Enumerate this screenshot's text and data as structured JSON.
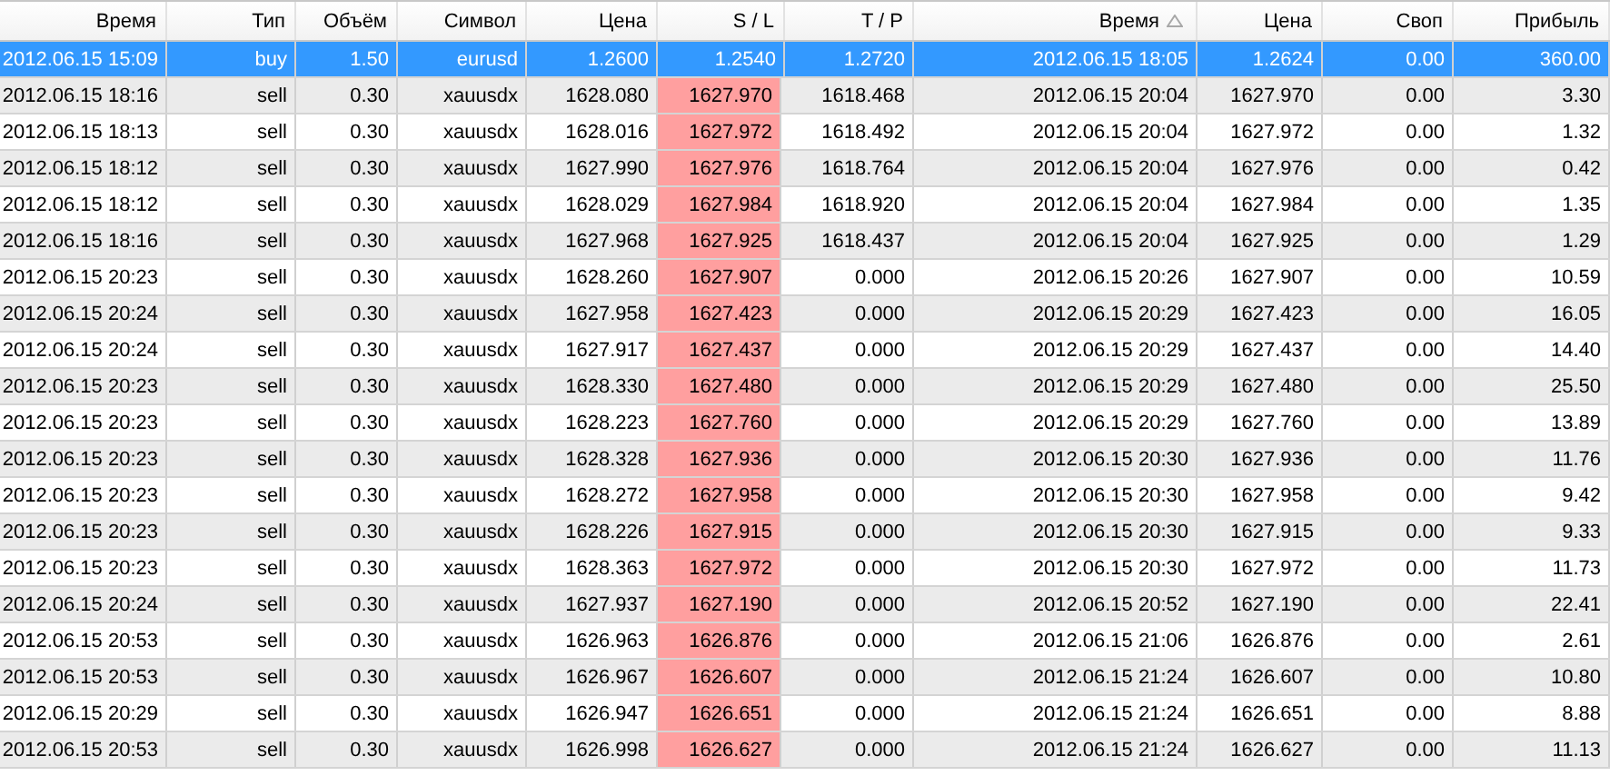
{
  "table": {
    "columns": [
      {
        "label": "Время"
      },
      {
        "label": "Тип"
      },
      {
        "label": "Объём"
      },
      {
        "label": "Символ"
      },
      {
        "label": "Цена"
      },
      {
        "label": "S / L"
      },
      {
        "label": "T / P"
      },
      {
        "label": "Время",
        "sorted": true
      },
      {
        "label": "Цена"
      },
      {
        "label": "Своп"
      },
      {
        "label": "Прибыль"
      }
    ],
    "rows": [
      {
        "selected": true,
        "sl_hit": false,
        "cells": [
          "2012.06.15 15:09",
          "buy",
          "1.50",
          "eurusd",
          "1.2600",
          "1.2540",
          "1.2720",
          "2012.06.15 18:05",
          "1.2624",
          "0.00",
          "360.00"
        ]
      },
      {
        "selected": false,
        "sl_hit": true,
        "cells": [
          "2012.06.15 18:16",
          "sell",
          "0.30",
          "xauusdx",
          "1628.080",
          "1627.970",
          "1618.468",
          "2012.06.15 20:04",
          "1627.970",
          "0.00",
          "3.30"
        ]
      },
      {
        "selected": false,
        "sl_hit": true,
        "cells": [
          "2012.06.15 18:13",
          "sell",
          "0.30",
          "xauusdx",
          "1628.016",
          "1627.972",
          "1618.492",
          "2012.06.15 20:04",
          "1627.972",
          "0.00",
          "1.32"
        ]
      },
      {
        "selected": false,
        "sl_hit": true,
        "cells": [
          "2012.06.15 18:12",
          "sell",
          "0.30",
          "xauusdx",
          "1627.990",
          "1627.976",
          "1618.764",
          "2012.06.15 20:04",
          "1627.976",
          "0.00",
          "0.42"
        ]
      },
      {
        "selected": false,
        "sl_hit": true,
        "cells": [
          "2012.06.15 18:12",
          "sell",
          "0.30",
          "xauusdx",
          "1628.029",
          "1627.984",
          "1618.920",
          "2012.06.15 20:04",
          "1627.984",
          "0.00",
          "1.35"
        ]
      },
      {
        "selected": false,
        "sl_hit": true,
        "cells": [
          "2012.06.15 18:16",
          "sell",
          "0.30",
          "xauusdx",
          "1627.968",
          "1627.925",
          "1618.437",
          "2012.06.15 20:04",
          "1627.925",
          "0.00",
          "1.29"
        ]
      },
      {
        "selected": false,
        "sl_hit": true,
        "cells": [
          "2012.06.15 20:23",
          "sell",
          "0.30",
          "xauusdx",
          "1628.260",
          "1627.907",
          "0.000",
          "2012.06.15 20:26",
          "1627.907",
          "0.00",
          "10.59"
        ]
      },
      {
        "selected": false,
        "sl_hit": true,
        "cells": [
          "2012.06.15 20:24",
          "sell",
          "0.30",
          "xauusdx",
          "1627.958",
          "1627.423",
          "0.000",
          "2012.06.15 20:29",
          "1627.423",
          "0.00",
          "16.05"
        ]
      },
      {
        "selected": false,
        "sl_hit": true,
        "cells": [
          "2012.06.15 20:24",
          "sell",
          "0.30",
          "xauusdx",
          "1627.917",
          "1627.437",
          "0.000",
          "2012.06.15 20:29",
          "1627.437",
          "0.00",
          "14.40"
        ]
      },
      {
        "selected": false,
        "sl_hit": true,
        "cells": [
          "2012.06.15 20:23",
          "sell",
          "0.30",
          "xauusdx",
          "1628.330",
          "1627.480",
          "0.000",
          "2012.06.15 20:29",
          "1627.480",
          "0.00",
          "25.50"
        ]
      },
      {
        "selected": false,
        "sl_hit": true,
        "cells": [
          "2012.06.15 20:23",
          "sell",
          "0.30",
          "xauusdx",
          "1628.223",
          "1627.760",
          "0.000",
          "2012.06.15 20:29",
          "1627.760",
          "0.00",
          "13.89"
        ]
      },
      {
        "selected": false,
        "sl_hit": true,
        "cells": [
          "2012.06.15 20:23",
          "sell",
          "0.30",
          "xauusdx",
          "1628.328",
          "1627.936",
          "0.000",
          "2012.06.15 20:30",
          "1627.936",
          "0.00",
          "11.76"
        ]
      },
      {
        "selected": false,
        "sl_hit": true,
        "cells": [
          "2012.06.15 20:23",
          "sell",
          "0.30",
          "xauusdx",
          "1628.272",
          "1627.958",
          "0.000",
          "2012.06.15 20:30",
          "1627.958",
          "0.00",
          "9.42"
        ]
      },
      {
        "selected": false,
        "sl_hit": true,
        "cells": [
          "2012.06.15 20:23",
          "sell",
          "0.30",
          "xauusdx",
          "1628.226",
          "1627.915",
          "0.000",
          "2012.06.15 20:30",
          "1627.915",
          "0.00",
          "9.33"
        ]
      },
      {
        "selected": false,
        "sl_hit": true,
        "cells": [
          "2012.06.15 20:23",
          "sell",
          "0.30",
          "xauusdx",
          "1628.363",
          "1627.972",
          "0.000",
          "2012.06.15 20:30",
          "1627.972",
          "0.00",
          "11.73"
        ]
      },
      {
        "selected": false,
        "sl_hit": true,
        "cells": [
          "2012.06.15 20:24",
          "sell",
          "0.30",
          "xauusdx",
          "1627.937",
          "1627.190",
          "0.000",
          "2012.06.15 20:52",
          "1627.190",
          "0.00",
          "22.41"
        ]
      },
      {
        "selected": false,
        "sl_hit": true,
        "cells": [
          "2012.06.15 20:53",
          "sell",
          "0.30",
          "xauusdx",
          "1626.963",
          "1626.876",
          "0.000",
          "2012.06.15 21:06",
          "1626.876",
          "0.00",
          "2.61"
        ]
      },
      {
        "selected": false,
        "sl_hit": true,
        "cells": [
          "2012.06.15 20:53",
          "sell",
          "0.30",
          "xauusdx",
          "1626.967",
          "1626.607",
          "0.000",
          "2012.06.15 21:24",
          "1626.607",
          "0.00",
          "10.80"
        ]
      },
      {
        "selected": false,
        "sl_hit": true,
        "cells": [
          "2012.06.15 20:29",
          "sell",
          "0.30",
          "xauusdx",
          "1626.947",
          "1626.651",
          "0.000",
          "2012.06.15 21:24",
          "1626.651",
          "0.00",
          "8.88"
        ]
      },
      {
        "selected": false,
        "sl_hit": true,
        "cells": [
          "2012.06.15 20:53",
          "sell",
          "0.30",
          "xauusdx",
          "1626.998",
          "1626.627",
          "0.000",
          "2012.06.15 21:24",
          "1626.627",
          "0.00",
          "11.13"
        ]
      }
    ]
  }
}
